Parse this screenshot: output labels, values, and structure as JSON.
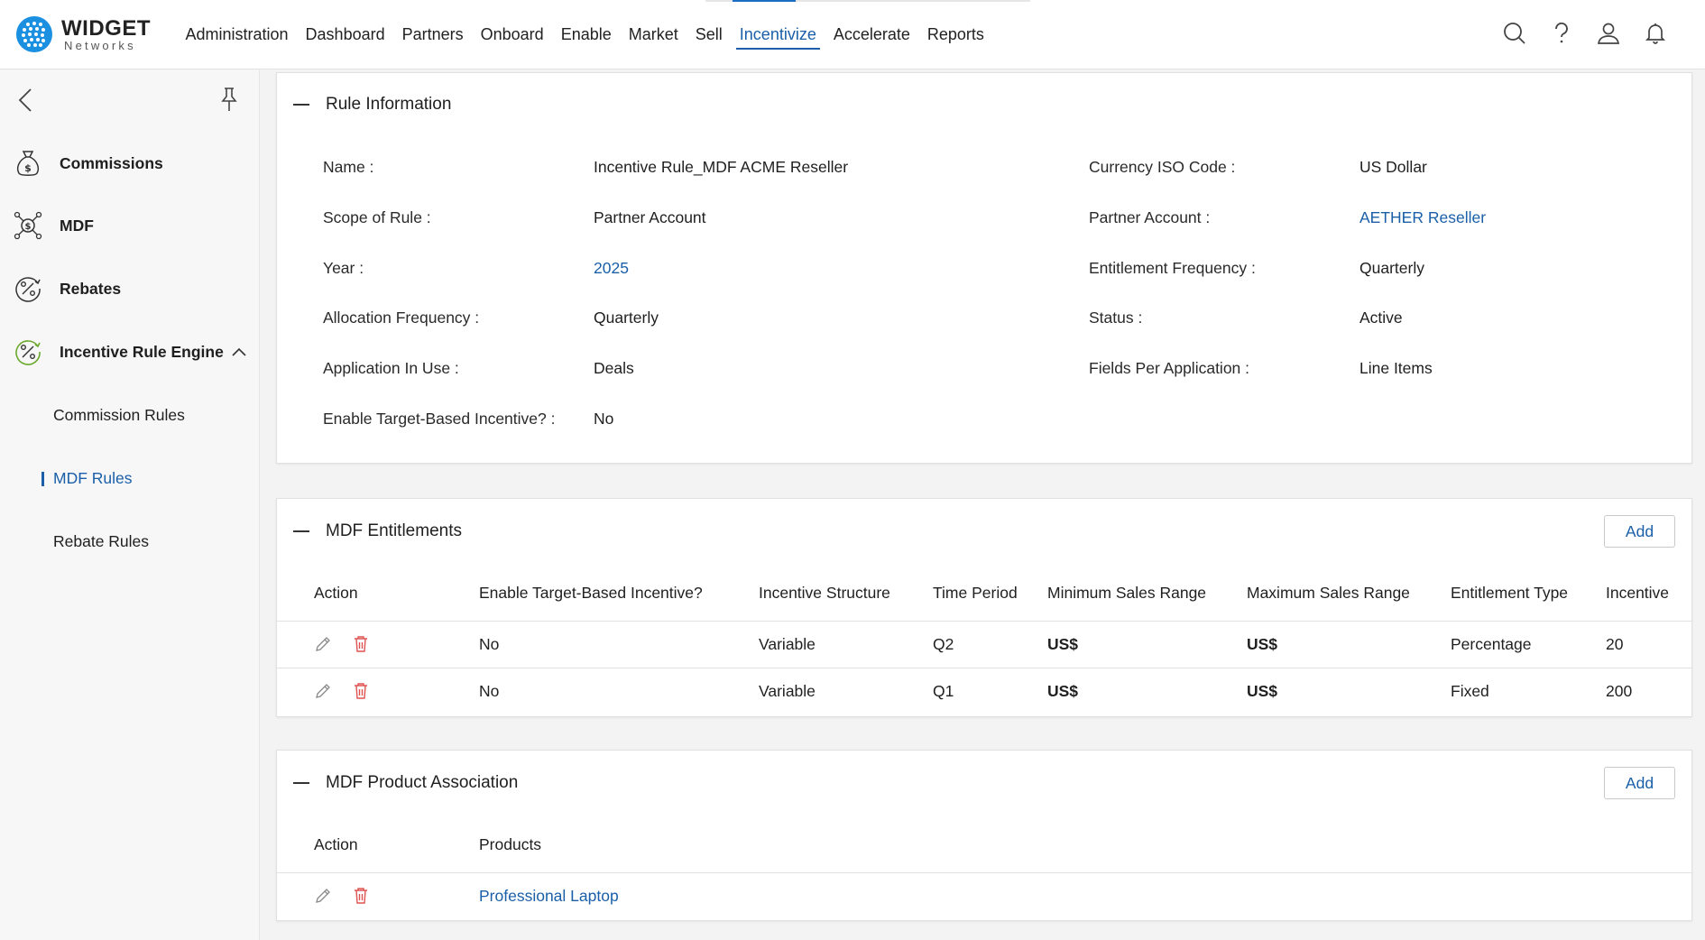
{
  "brand": {
    "name": "WIDGET",
    "sub": "Networks"
  },
  "nav": [
    "Administration",
    "Dashboard",
    "Partners",
    "Onboard",
    "Enable",
    "Market",
    "Sell",
    "Incentivize",
    "Accelerate",
    "Reports"
  ],
  "sidebar": {
    "items": [
      {
        "label": "Commissions"
      },
      {
        "label": "MDF"
      },
      {
        "label": "Rebates"
      },
      {
        "label": "Incentive Rule Engine"
      }
    ],
    "subitems": [
      {
        "label": "Commission Rules"
      },
      {
        "label": "MDF Rules"
      },
      {
        "label": "Rebate Rules"
      }
    ]
  },
  "rule_info": {
    "title": "Rule Information",
    "left": [
      {
        "label": "Name :",
        "value": "Incentive Rule_MDF ACME Reseller"
      },
      {
        "label": "Scope of Rule :",
        "value": "Partner Account"
      },
      {
        "label": "Year :",
        "value": "2025"
      },
      {
        "label": "Allocation Frequency :",
        "value": "Quarterly"
      },
      {
        "label": "Application In Use :",
        "value": "Deals"
      },
      {
        "label": "Enable Target-Based Incentive? :",
        "value": "No"
      }
    ],
    "right": [
      {
        "label": "Currency ISO Code :",
        "value": "US Dollar"
      },
      {
        "label": "Partner Account :",
        "value": "AETHER Reseller"
      },
      {
        "label": "Entitlement Frequency :",
        "value": "Quarterly"
      },
      {
        "label": "Status :",
        "value": "Active"
      },
      {
        "label": "Fields Per Application :",
        "value": "Line Items"
      }
    ]
  },
  "entitlements": {
    "title": "MDF Entitlements",
    "add_label": "Add",
    "columns": [
      "Action",
      "Enable Target-Based Incentive?",
      "Incentive Structure",
      "Time Period",
      "Minimum Sales Range",
      "Maximum Sales Range",
      "Entitlement Type",
      "Incentive"
    ],
    "rows": [
      [
        "No",
        "Variable",
        "Q2",
        "US$",
        "US$",
        "Percentage",
        "20"
      ],
      [
        "No",
        "Variable",
        "Q1",
        "US$",
        "US$",
        "Fixed",
        "200"
      ]
    ]
  },
  "products": {
    "title": "MDF Product Association",
    "add_label": "Add",
    "columns": [
      "Action",
      "Products"
    ],
    "rows": [
      [
        "Professional Laptop"
      ]
    ]
  },
  "colors": {
    "accent": "#1a5fa8",
    "delete": "#e05252",
    "active_icon": "#6aa92c"
  }
}
